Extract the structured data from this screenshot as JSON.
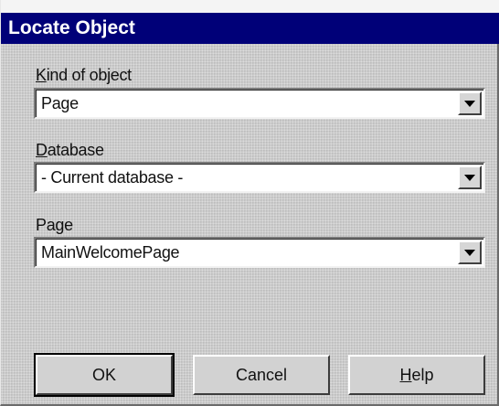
{
  "window": {
    "title": "Locate Object"
  },
  "fields": {
    "kind": {
      "label_accel": "K",
      "label_rest": "ind of object",
      "value": "Page"
    },
    "database": {
      "label_accel": "D",
      "label_rest": "atabase",
      "value": "- Current database -"
    },
    "page": {
      "label": "Page",
      "value": "MainWelcomePage"
    }
  },
  "buttons": {
    "ok": "OK",
    "cancel": "Cancel",
    "help_accel": "H",
    "help_rest": "elp"
  },
  "colors": {
    "titlebar": "#000078",
    "dialog_face": "#c9c9c9"
  },
  "icons": {
    "dropdown": "chevron-down-icon"
  }
}
